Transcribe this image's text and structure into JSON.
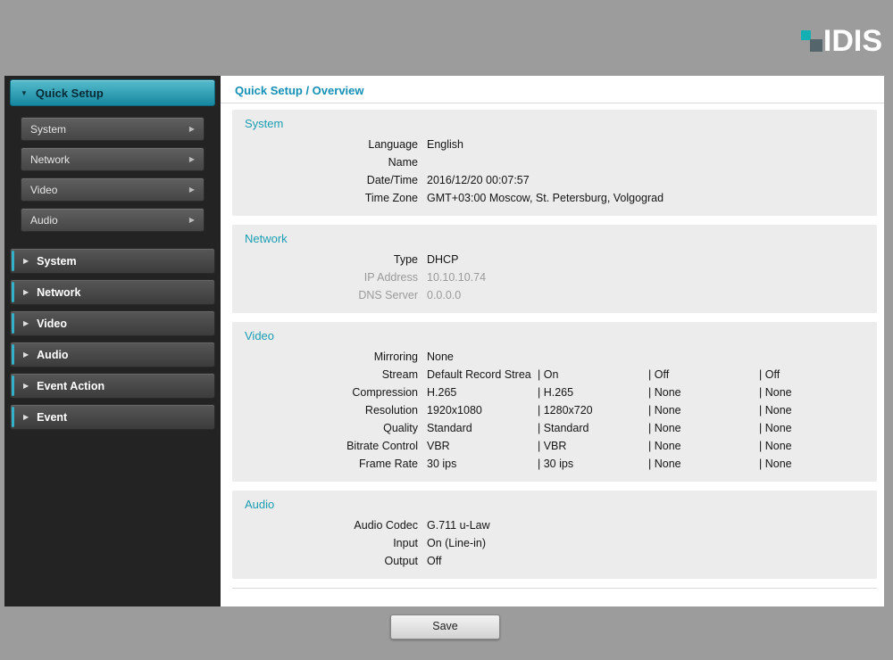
{
  "logo": {
    "text": "IDIS"
  },
  "colors": {
    "accent_teal": "#1b9db4",
    "sidebar_active": "#2fa9c0",
    "logo_teal": "#12b0b2",
    "muted_text": "#9a9a9a"
  },
  "sidebar": {
    "quick_setup_label": "Quick Setup",
    "quick_items": [
      {
        "label": "System"
      },
      {
        "label": "Network"
      },
      {
        "label": "Video"
      },
      {
        "label": "Audio"
      }
    ],
    "main_items": [
      {
        "label": "System"
      },
      {
        "label": "Network"
      },
      {
        "label": "Video"
      },
      {
        "label": "Audio"
      },
      {
        "label": "Event Action"
      },
      {
        "label": "Event"
      }
    ]
  },
  "content": {
    "breadcrumb": "Quick Setup / Overview",
    "sections": [
      {
        "title": "System",
        "rows": [
          {
            "label": "Language",
            "values": [
              "English"
            ]
          },
          {
            "label": "Name",
            "values": [
              ""
            ]
          },
          {
            "label": "Date/Time",
            "values": [
              "2016/12/20 00:07:57"
            ]
          },
          {
            "label": "Time Zone",
            "values": [
              "GMT+03:00 Moscow, St. Petersburg, Volgograd"
            ]
          }
        ]
      },
      {
        "title": "Network",
        "rows": [
          {
            "label": "Type",
            "values": [
              "DHCP"
            ]
          },
          {
            "label": "IP Address",
            "values": [
              "10.10.10.74"
            ],
            "muted": true
          },
          {
            "label": "DNS Server",
            "values": [
              "0.0.0.0"
            ],
            "muted": true
          }
        ]
      },
      {
        "title": "Video",
        "rows": [
          {
            "label": "Mirroring",
            "values": [
              "None"
            ]
          },
          {
            "label": "Stream",
            "values": [
              "Default Record Strea",
              "| On",
              "| Off",
              "| Off"
            ]
          },
          {
            "label": "Compression",
            "values": [
              "H.265",
              "| H.265",
              "| None",
              "| None"
            ]
          },
          {
            "label": "Resolution",
            "values": [
              "1920x1080",
              "| 1280x720",
              "| None",
              "| None"
            ]
          },
          {
            "label": "Quality",
            "values": [
              "Standard",
              "| Standard",
              "| None",
              "| None"
            ]
          },
          {
            "label": "Bitrate Control",
            "values": [
              "VBR",
              "| VBR",
              "| None",
              "| None"
            ]
          },
          {
            "label": "Frame Rate",
            "values": [
              "30 ips",
              "| 30 ips",
              "| None",
              "| None"
            ]
          }
        ]
      },
      {
        "title": "Audio",
        "rows": [
          {
            "label": "Audio Codec",
            "values": [
              "G.711 u-Law"
            ]
          },
          {
            "label": "Input",
            "values": [
              "On (Line-in)"
            ]
          },
          {
            "label": "Output",
            "values": [
              "Off"
            ]
          }
        ]
      }
    ]
  },
  "footer": {
    "save_label": "Save"
  }
}
